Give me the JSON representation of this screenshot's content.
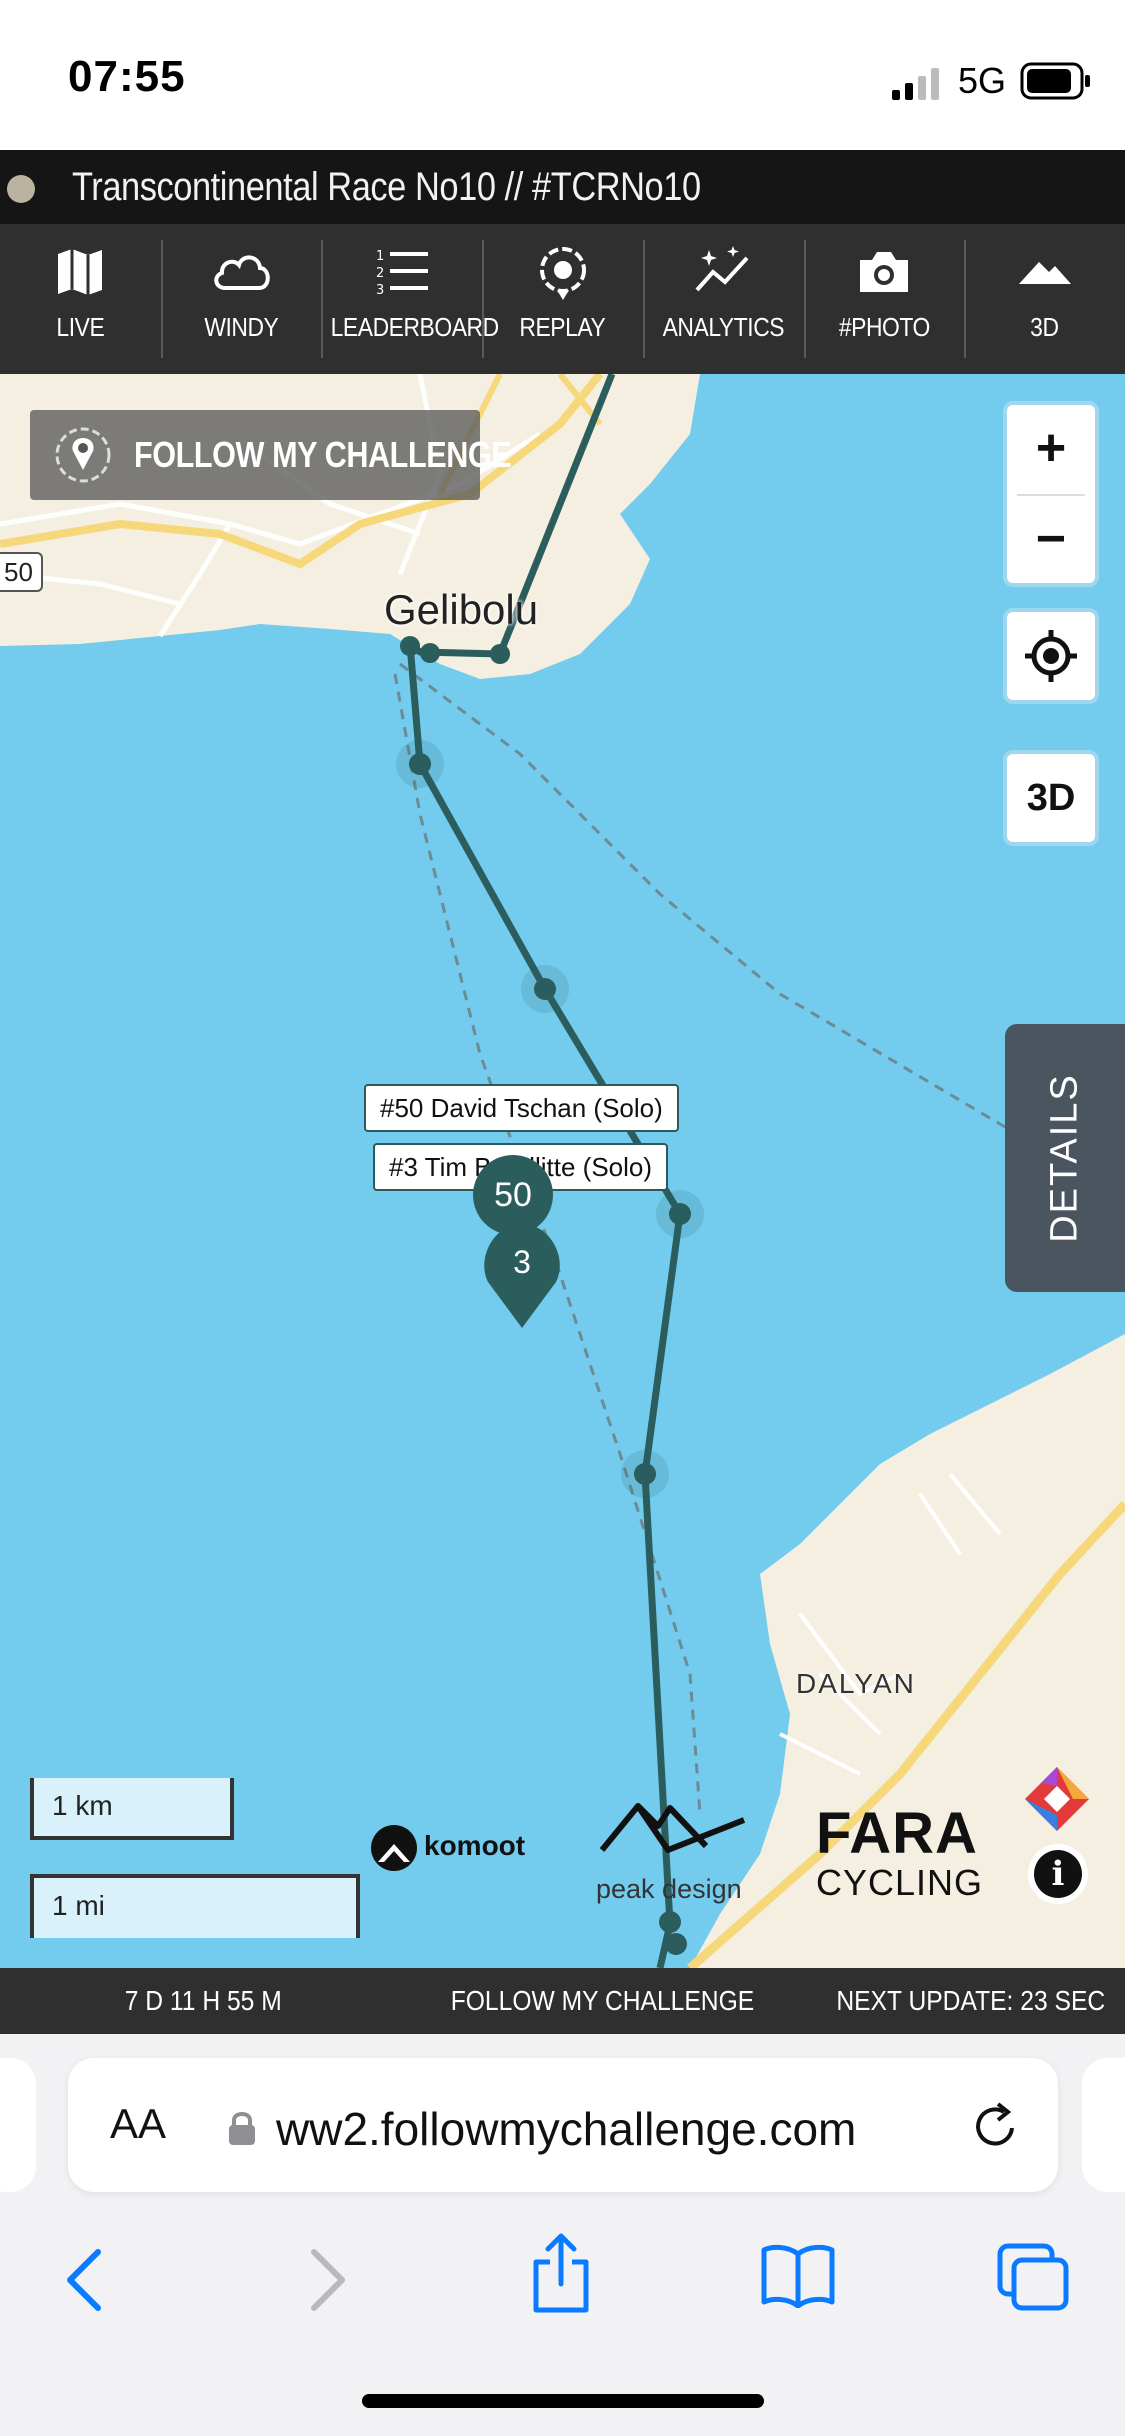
{
  "status_bar": {
    "time": "07:55",
    "network": "5G"
  },
  "title_bar": {
    "title": "Transcontinental Race No10 // #TCRNo10"
  },
  "toolbar": {
    "items": [
      {
        "label": "LIVE",
        "icon": "map-icon"
      },
      {
        "label": "WINDY",
        "icon": "cloud-icon"
      },
      {
        "label": "LEADERBOARD",
        "icon": "list-icon"
      },
      {
        "label": "REPLAY",
        "icon": "replay-pin-icon"
      },
      {
        "label": "ANALYTICS",
        "icon": "analytics-icon"
      },
      {
        "label": "#PHOTO",
        "icon": "camera-icon"
      },
      {
        "label": "3D",
        "icon": "mountain-icon"
      }
    ]
  },
  "map": {
    "follow_button": "FOLLOW MY CHALLENGE",
    "road_shield": "50",
    "place_gelibolu": "Gelibolu",
    "place_dalyan": "DALYAN",
    "zoom_in": "+",
    "zoom_out": "−",
    "three_d": "3D",
    "details": "DETAILS",
    "riders": [
      {
        "tooltip": "#50 David Tschan (Solo)",
        "marker": "50"
      },
      {
        "tooltip": "#3 Tim Bandlitte (Solo)",
        "marker": "3"
      }
    ],
    "scale_km": "1 km",
    "scale_mi": "1 mi",
    "sponsors": {
      "komoot": "komoot",
      "peak_design": "peak design",
      "fara_top": "FARA",
      "fara_bottom": "CYCLING"
    },
    "info": "i"
  },
  "info_bar": {
    "elapsed": "7 D 11 H 55 M",
    "brand": "FOLLOW MY CHALLENGE",
    "next_update": "NEXT UPDATE: 23 SEC"
  },
  "safari": {
    "text_size": "AA",
    "url": "ww2.followmychallenge.com"
  }
}
